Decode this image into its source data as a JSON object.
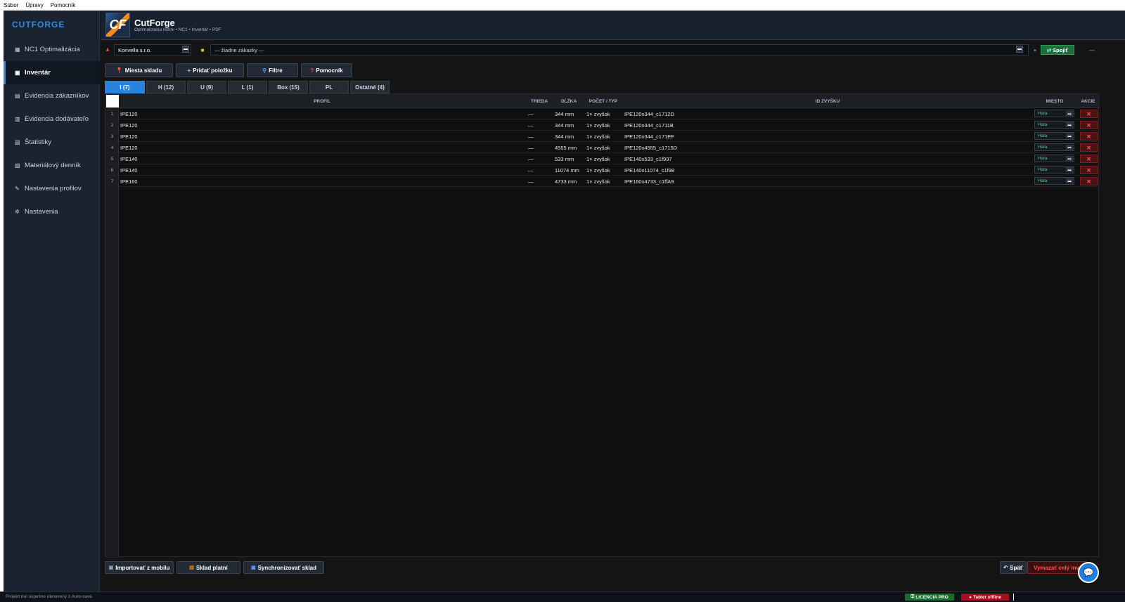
{
  "menubar": {
    "file": "Súbor",
    "edit": "Úpravy",
    "help": "Pomocník"
  },
  "sidebar": {
    "brand": "CUTFORGE",
    "items": [
      {
        "icon": "▦",
        "label": "NC1  Optimalizácia"
      },
      {
        "icon": "▣",
        "label": "Inventár"
      },
      {
        "icon": "▤",
        "label": "Evidencia zákazníkov"
      },
      {
        "icon": "▥",
        "label": "Evidencia dodávateľo"
      },
      {
        "icon": "▧",
        "label": "Štatistiky"
      },
      {
        "icon": "▨",
        "label": "Materiálový denník"
      },
      {
        "icon": "✎",
        "label": "Nastavenia profilov"
      },
      {
        "icon": "✲",
        "label": "Nastavenia"
      }
    ]
  },
  "header": {
    "logo_text": "CF",
    "title": "CutForge",
    "subtitle": "Optimalizácia rezov • NC1 • Inventár • PDF"
  },
  "selectors": {
    "customer": "Konvella s.r.o.",
    "order": "— žiadne zákazky —",
    "connect_label": "Spojiť",
    "plus": "+",
    "minus": "—"
  },
  "toolbar": {
    "places": "Miesta skladu",
    "add": "Pridať položku",
    "filters": "Filtre",
    "helper": "Pomocník"
  },
  "tabs": [
    "I (7)",
    "H (12)",
    "U (9)",
    "L (1)",
    "Box (15)",
    "PL",
    "Ostatné (4)"
  ],
  "table": {
    "headers": {
      "profile": "PROFIL",
      "class": "TRIEDA",
      "length": "DĹŽKA",
      "count": "POČET / TYP",
      "id": "ID ZVYŠKU",
      "place": "MIESTO",
      "actions": "AKCIE"
    },
    "rows": [
      {
        "n": "1",
        "profile": "IPE120",
        "class": "—",
        "length": "344 mm",
        "count": "1× zvyšok",
        "id": "IPE120x344_c1712D",
        "place": "Hala"
      },
      {
        "n": "2",
        "profile": "IPE120",
        "class": "—",
        "length": "344 mm",
        "count": "1× zvyšok",
        "id": "IPE120x344_c1711B",
        "place": "Hala"
      },
      {
        "n": "3",
        "profile": "IPE120",
        "class": "—",
        "length": "344 mm",
        "count": "1× zvyšok",
        "id": "IPE120x344_c171EF",
        "place": "Hala"
      },
      {
        "n": "4",
        "profile": "IPE120",
        "class": "—",
        "length": "4555 mm",
        "count": "1× zvyšok",
        "id": "IPE120x4555_c1715D",
        "place": "Hala"
      },
      {
        "n": "5",
        "profile": "IPE140",
        "class": "—",
        "length": "533 mm",
        "count": "1× zvyšok",
        "id": "IPE140x533_c1f997",
        "place": "Hala"
      },
      {
        "n": "6",
        "profile": "IPE140",
        "class": "—",
        "length": "11074 mm",
        "count": "1× zvyšok",
        "id": "IPE140x11074_c1f98",
        "place": "Hala"
      },
      {
        "n": "7",
        "profile": "IPE160",
        "class": "—",
        "length": "4733 mm",
        "count": "1× zvyšok",
        "id": "IPE160x4733_c1ffA9",
        "place": "Hala"
      }
    ]
  },
  "footer": {
    "import": "Importovať z mobilu",
    "pay": "Sklad platní",
    "sync": "Synchronizovať sklad",
    "back": "Späť",
    "clear": "Vymazať celý inv"
  },
  "status": {
    "message": "Projekt bol úspešne obnovený z Auto-save.",
    "license": "LICENCIA PRO",
    "tablet": "Tablet offline"
  },
  "colors": {
    "accent": "#2783dc",
    "danger": "#ff4d4d",
    "ok": "#4ec27a"
  }
}
